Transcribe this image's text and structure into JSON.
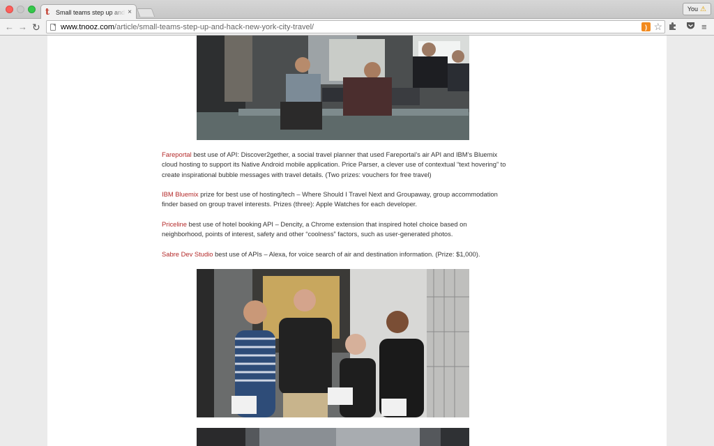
{
  "browser": {
    "tab_title": "Small teams step up and hack New York City travel",
    "tab_close": "×",
    "profile_label": "You",
    "url_host": "www.tnooz.com",
    "url_path": "/article/small-teams-step-up-and-hack-new-york-city-travel/",
    "icons": [
      "back-arrow-icon",
      "forward-arrow-icon",
      "reload-icon",
      "page-icon",
      "rss-icon",
      "star-icon",
      "puzzle-icon",
      "pocket-icon",
      "menu-icon"
    ]
  },
  "article": {
    "paragraphs": [
      {
        "sponsor": "Fareportal",
        "text": " best use of API: Discover2gether, a social travel planner that used Fareportal’s air API and IBM’s Bluemix cloud hosting to support its Native Android mobile application. Price Parser, a clever use of contextual “text hovering” to create inspirational bubble messages with travel details. (Two prizes: vouchers for free travel)"
      },
      {
        "sponsor": "IBM Bluemix",
        "text": " prize for best use of hosting/tech – Where Should I Travel Next and Groupaway, group accommodation finder based on group travel interests. Prizes (three): Apple Watches for each developer."
      },
      {
        "sponsor": "Priceline",
        "text": " best use of hotel booking API – Dencity, a Chrome extension that inspired hotel choice based on neighborhood, points of interest, safety and other “coolness” factors, such as user-generated photos."
      },
      {
        "sponsor": "Sabre Dev Studio",
        "text": " best use of APIs – Alexa, for voice search of air and destination information. (Prize: $1,000)."
      }
    ]
  },
  "colors": {
    "sponsor_link": "#b42a2a",
    "body_text": "#333333"
  }
}
